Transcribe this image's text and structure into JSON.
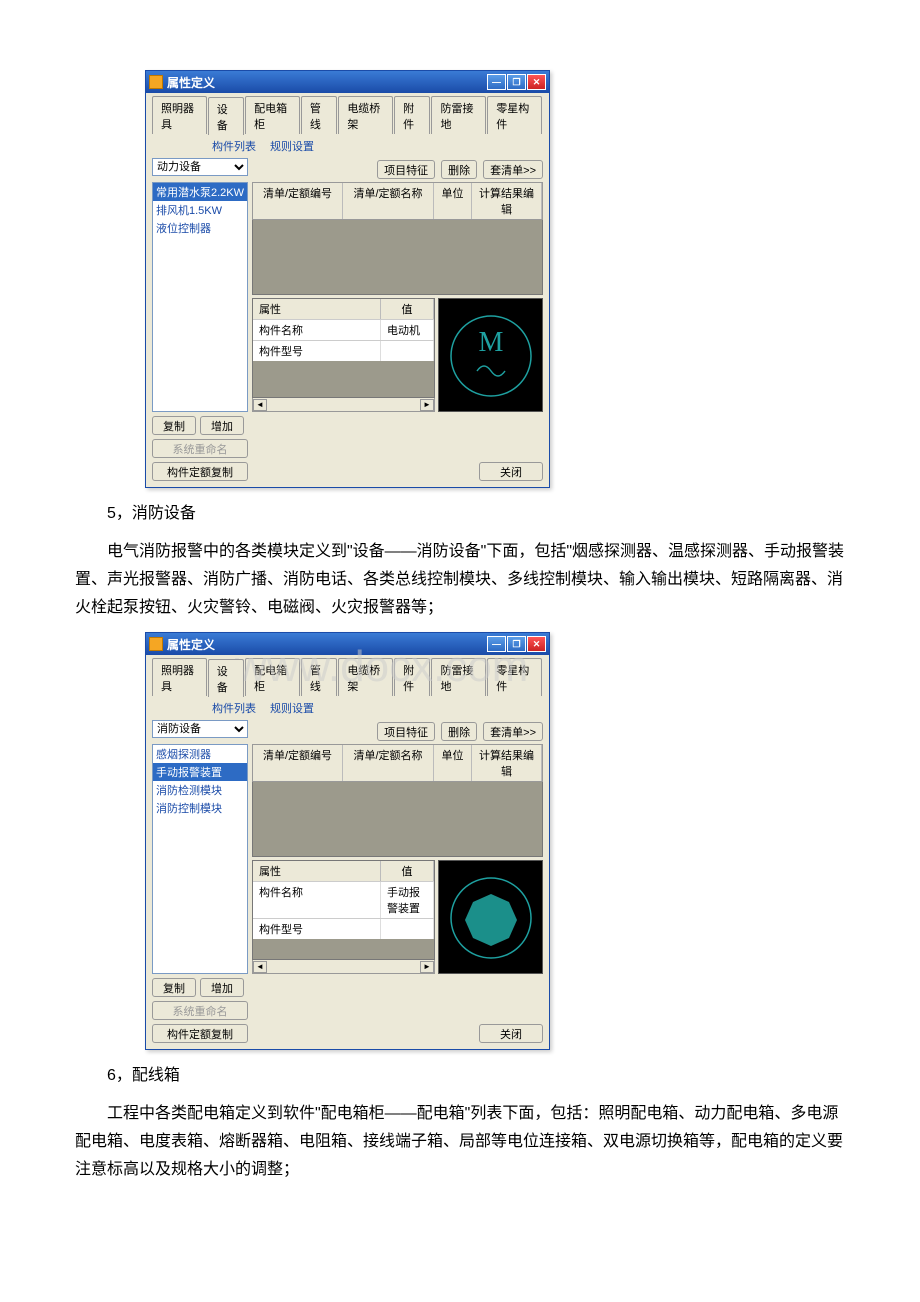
{
  "dlg1": {
    "title": "属性定义",
    "tabs": [
      "照明器具",
      "设备",
      "配电箱柜",
      "管线",
      "电缆桥架",
      "附件",
      "防雷接地",
      "零星构件"
    ],
    "subLabels": [
      "构件列表",
      "规则设置"
    ],
    "dropdown": "动力设备",
    "btns": {
      "proj": "项目特征",
      "del": "删除",
      "fullList": "套清单>>"
    },
    "listItems": [
      "常用潜水泵2.2KW",
      "排风机1.5KW",
      "液位控制器"
    ],
    "gridHead": {
      "c1": "清单/定额编号",
      "c2": "清单/定额名称",
      "c3": "单位",
      "c4": "计算结果编辑"
    },
    "propHead": {
      "c1": "属性",
      "c2": "值"
    },
    "propRows": [
      {
        "k": "构件名称",
        "v": "电动机"
      },
      {
        "k": "构件型号",
        "v": ""
      }
    ],
    "btnCopy": "复制",
    "btnAdd": "增加",
    "btnRename": "系统重命名",
    "btnCompCopy": "构件定额复制",
    "btnClose": "关闭"
  },
  "text1": {
    "h": "5，消防设备",
    "p": "电气消防报警中的各类模块定义到\"设备——消防设备\"下面，包括\"烟感探测器、温感探测器、手动报警装置、声光报警器、消防广播、消防电话、各类总线控制模块、多线控制模块、输入输出模块、短路隔离器、消火栓起泵按钮、火灾警铃、电磁阀、火灾报警器等；"
  },
  "dlg2": {
    "title": "属性定义",
    "tabs": [
      "照明器具",
      "设备",
      "配电箱柜",
      "管线",
      "电缆桥架",
      "附件",
      "防雷接地",
      "零星构件"
    ],
    "subLabels": [
      "构件列表",
      "规则设置"
    ],
    "dropdown": "消防设备",
    "btns": {
      "proj": "项目特征",
      "del": "删除",
      "fullList": "套清单>>"
    },
    "listItems": [
      "感烟探测器",
      "手动报警装置",
      "消防检测模块",
      "消防控制模块"
    ],
    "listSelIndex": 1,
    "gridHead": {
      "c1": "清单/定额编号",
      "c2": "清单/定额名称",
      "c3": "单位",
      "c4": "计算结果编辑"
    },
    "propHead": {
      "c1": "属性",
      "c2": "值"
    },
    "propRows": [
      {
        "k": "构件名称",
        "v": "手动报警装置"
      },
      {
        "k": "构件型号",
        "v": ""
      }
    ],
    "btnCopy": "复制",
    "btnAdd": "增加",
    "btnRename": "系统重命名",
    "btnCompCopy": "构件定额复制",
    "btnClose": "关闭"
  },
  "text2": {
    "h": "6，配线箱",
    "p": "工程中各类配电箱定义到软件\"配电箱柜——配电箱\"列表下面，包括：照明配电箱、动力配电箱、多电源配电箱、电度表箱、熔断器箱、电阻箱、接线端子箱、局部等电位连接箱、双电源切换箱等，配电箱的定义要注意标高以及规格大小的调整；"
  },
  "watermark": "www.docx.com"
}
